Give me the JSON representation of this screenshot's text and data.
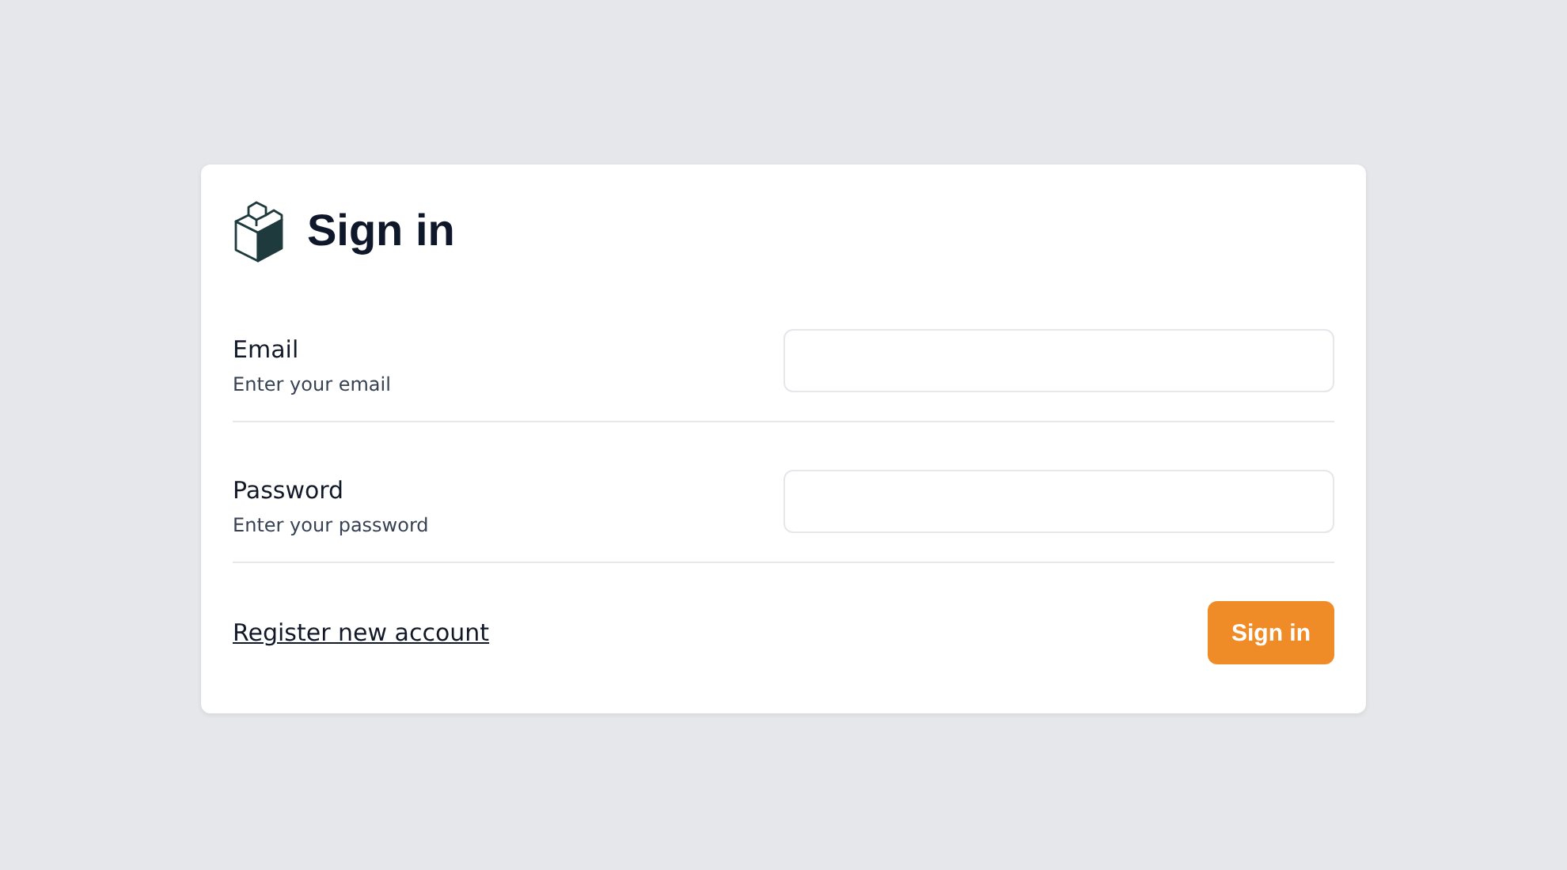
{
  "title": "Sign in",
  "email": {
    "label": "Email",
    "hint": "Enter your email"
  },
  "password": {
    "label": "Password",
    "hint": "Enter your password"
  },
  "register_link": "Register new account",
  "submit_button": "Sign in"
}
